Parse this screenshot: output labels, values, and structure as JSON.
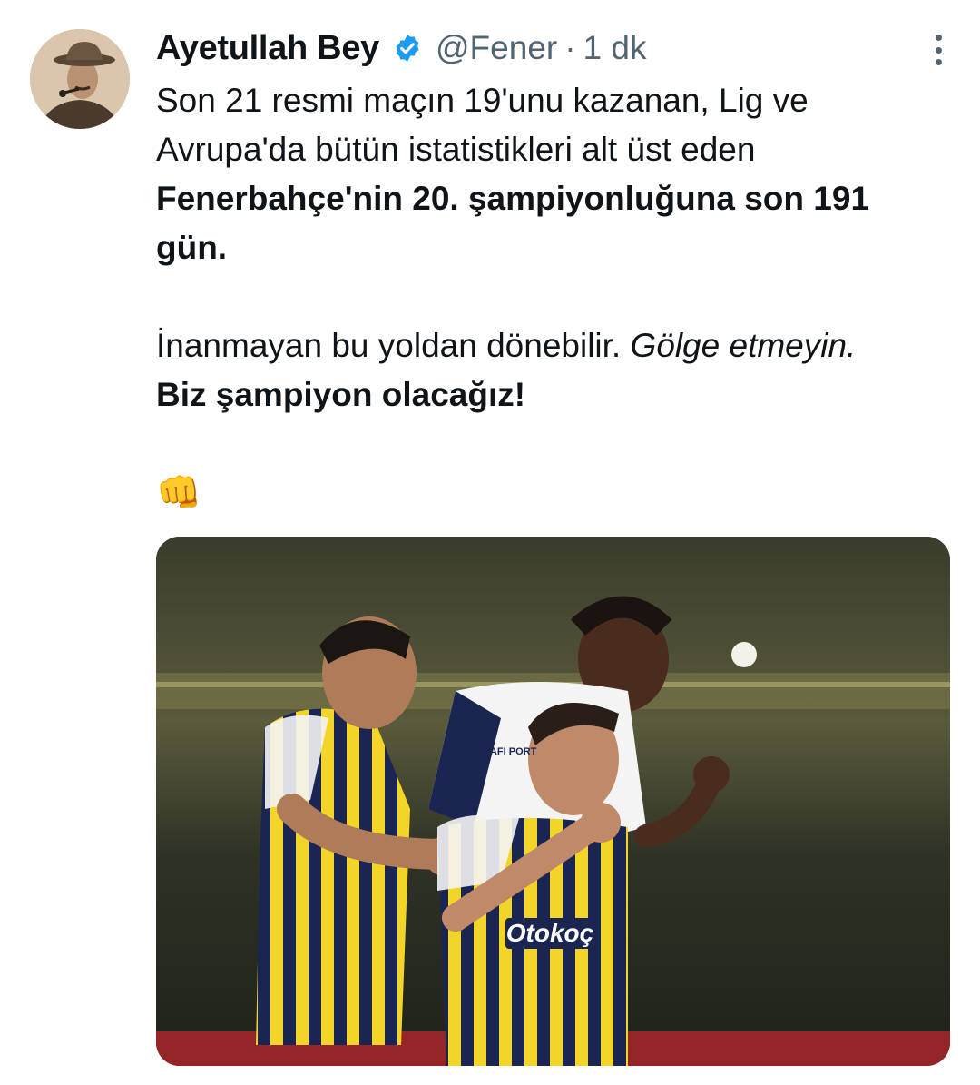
{
  "tweet": {
    "author_name": "Ayetullah Bey",
    "handle": "@Fener",
    "separator": "·",
    "time": "1 dk",
    "verified": true,
    "line1": "Son 21 resmi maçın 19'unu kazanan, Lig ve",
    "line2": "Avrupa'da bütün istatistikleri alt üst eden",
    "line3": "Fenerbahçe'nin 20. şampiyonluğuna son 191",
    "line4": "gün.",
    "line5_normal": "İnanmayan bu yoldan dönebilir. ",
    "line5_italic": "Gölge etmeyin.",
    "line6": "Biz şampiyon olacağız!",
    "emoji": "👊"
  },
  "media": {
    "kit_sponsor": "Otokoç",
    "sleeve_sponsor": "SAFI PORT"
  },
  "colors": {
    "text": "#0f1419",
    "muted": "#536471",
    "verified": "#1d9bf0",
    "kit_navy": "#1b2552",
    "kit_yellow": "#f3d52a"
  }
}
